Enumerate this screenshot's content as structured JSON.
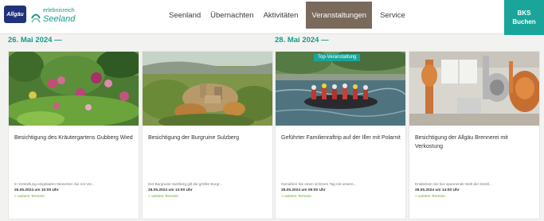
{
  "header": {
    "logo_primary": "Allgäu",
    "logo_secondary_line1": "erlebnisreich",
    "logo_secondary_line2": "Seeland",
    "nav": [
      "Seenland",
      "Übernachten",
      "Aktivitäten",
      "Veranstaltungen",
      "Service"
    ],
    "active_nav": "Veranstaltungen",
    "book_line1": "BKS",
    "book_line2": "Buchen",
    "accent_color": "#1aa59a",
    "active_color": "#7a6a5c"
  },
  "dates": [
    "26. Mai 2024 —",
    "28. Mai 2024 —"
  ],
  "cards": [
    {
      "title": "Besichtigung des Kräutergartens Gubberg Wied",
      "excerpt": "In Vorstellung eingeladen! Bewerten Sie mit Vor...",
      "datetime": "26.05.2024 um 10:00 Uhr",
      "link": "> weitere Termine",
      "tag": ""
    },
    {
      "title": "Besichtigung der Burgruine Sulzberg",
      "excerpt": "Der Burgruine Sulzberg gilt die größte Burgr...",
      "datetime": "26.05.2024 um 13:00 Uhr",
      "link": "> weitere Termine",
      "tag": ""
    },
    {
      "title": "Geführter Familienraftrip auf der Iller mit Polarnit",
      "excerpt": "Genießen Sie einen schönen Tag mit unsere...",
      "datetime": "28.05.2024 um 09:00 Uhr",
      "link": "> weitere Termine",
      "tag": "Top-Veranstaltung"
    },
    {
      "title": "Besichtigung der Allgäu Brennerei mit Verkostung",
      "excerpt": "Entdecken Sie live spannende Welt der Destil...",
      "datetime": "28.05.2024 um 14:00 Uhr",
      "link": "> weitere Termine",
      "tag": ""
    }
  ]
}
